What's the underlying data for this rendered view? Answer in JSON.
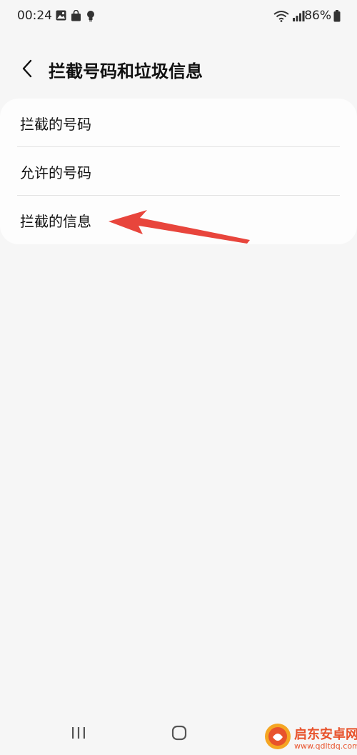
{
  "status_bar": {
    "time": "00:24",
    "battery_percent": "86%",
    "icons": [
      "gallery-icon",
      "shopping-bag-icon",
      "bulb-icon",
      "wifi-icon",
      "signal-icon",
      "battery-icon"
    ]
  },
  "header": {
    "back_icon": "chevron-left-icon",
    "title": "拦截号码和垃圾信息"
  },
  "settings": {
    "items": [
      {
        "label": "拦截的号码"
      },
      {
        "label": "允许的号码"
      },
      {
        "label": "拦截的信息"
      }
    ]
  },
  "annotation": {
    "color": "#e8453c",
    "target": "拦截的信息"
  },
  "nav_bar": {
    "icons": [
      "recents-icon",
      "home-icon",
      "back-nav-icon"
    ]
  },
  "watermark": {
    "brand": "启东安卓网",
    "url": "www.qdltdq.com"
  },
  "colors": {
    "background": "#f6f6f6",
    "card": "#fdfdfd",
    "divider": "#e3e3e3",
    "text": "#111111"
  }
}
